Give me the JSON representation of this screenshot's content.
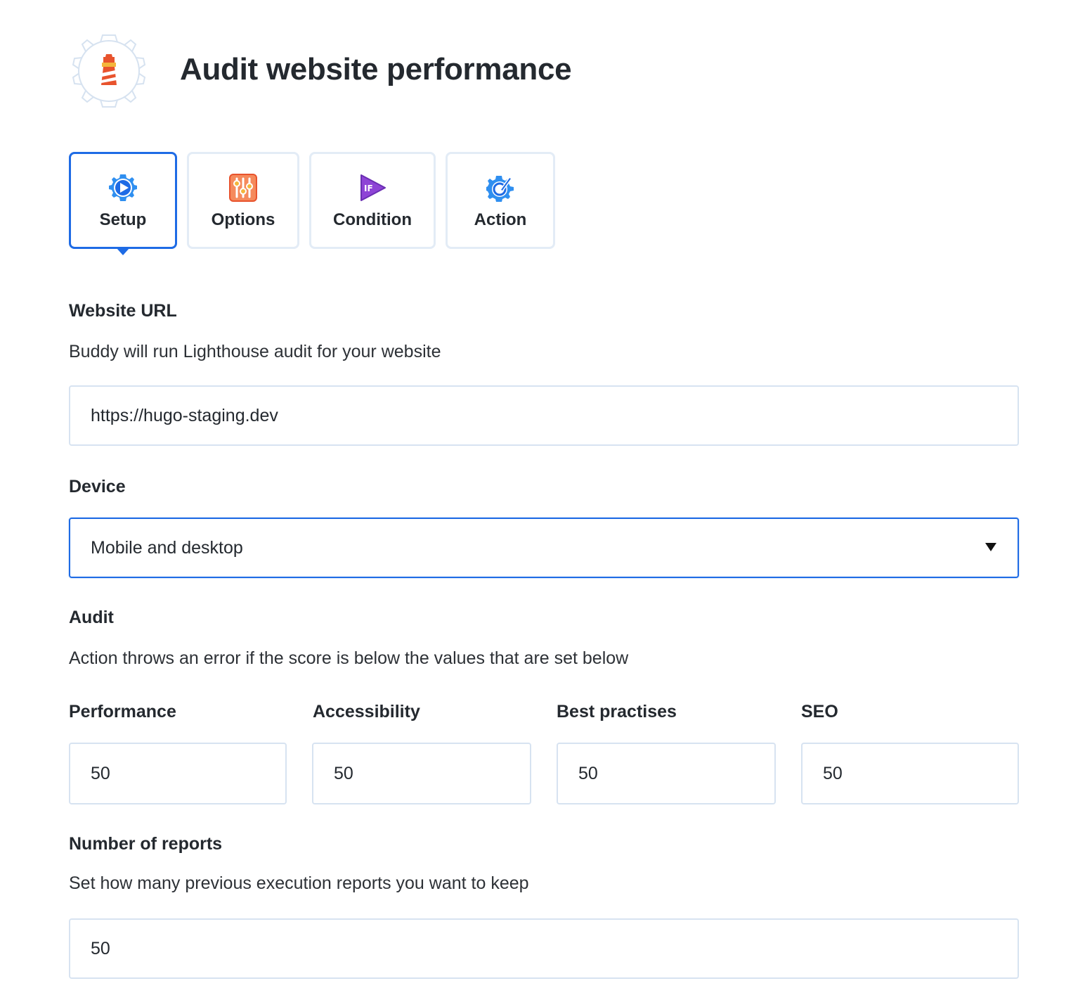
{
  "header": {
    "title": "Audit website performance",
    "logo_icon": "lighthouse-gear-icon"
  },
  "tabs": [
    {
      "label": "Setup",
      "icon": "gear-play-icon",
      "active": true
    },
    {
      "label": "Options",
      "icon": "sliders-icon",
      "active": false
    },
    {
      "label": "Condition",
      "icon": "if-play-icon",
      "active": false
    },
    {
      "label": "Action",
      "icon": "gear-pointer-icon",
      "active": false
    }
  ],
  "website": {
    "label": "Website URL",
    "help": "Buddy will run Lighthouse audit for your website",
    "value": "https://hugo-staging.dev"
  },
  "device": {
    "label": "Device",
    "selected": "Mobile and desktop"
  },
  "audit": {
    "label": "Audit",
    "help": "Action throws an error if the score is below the values that are set below",
    "scores": [
      {
        "label": "Performance",
        "value": "50"
      },
      {
        "label": "Accessibility",
        "value": "50"
      },
      {
        "label": "Best practises",
        "value": "50"
      },
      {
        "label": "SEO",
        "value": "50"
      }
    ]
  },
  "reports": {
    "label": "Number of reports",
    "help": "Set how many previous execution reports you want to keep",
    "value": "50"
  },
  "colors": {
    "accent": "#1e6be5",
    "border": "#d7e3f1",
    "lighthouse_red": "#e8532d",
    "lighthouse_yellow": "#f4b63b"
  }
}
